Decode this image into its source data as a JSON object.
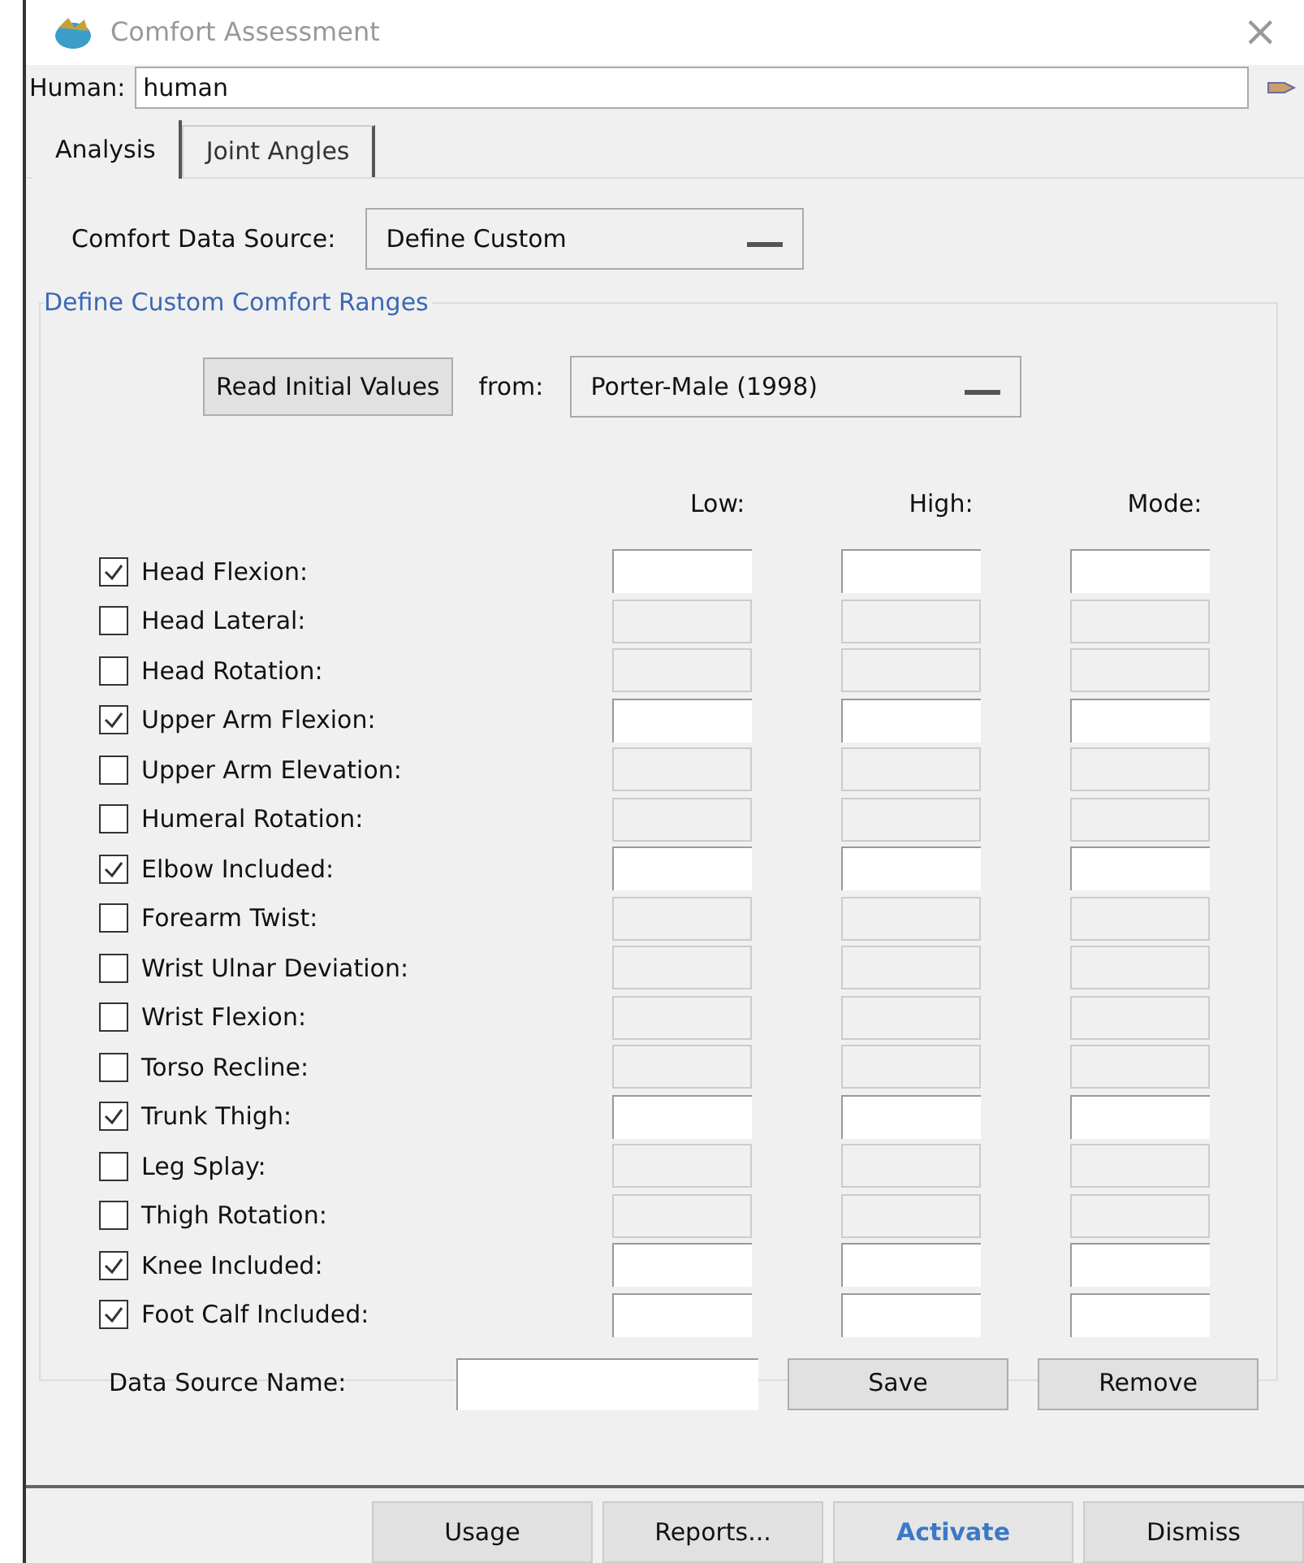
{
  "window": {
    "title": "Comfort Assessment",
    "close": "×"
  },
  "human": {
    "label": "Human:",
    "value": "human"
  },
  "tabs": [
    {
      "label": "Analysis",
      "selected": true
    },
    {
      "label": "Joint Angles",
      "selected": false
    }
  ],
  "source": {
    "label": "Comfort Data Source:",
    "value": "Define Custom"
  },
  "group": {
    "title": "Define Custom Comfort Ranges",
    "read_button": "Read Initial Values",
    "from_label": "from:",
    "from_value": "Porter-Male (1998)",
    "columns": [
      "Low:",
      "High:",
      "Mode:"
    ],
    "rows": [
      {
        "label": "Head Flexion:",
        "checked": true
      },
      {
        "label": "Head Lateral:",
        "checked": false
      },
      {
        "label": "Head Rotation:",
        "checked": false
      },
      {
        "label": "Upper Arm Flexion:",
        "checked": true
      },
      {
        "label": "Upper Arm Elevation:",
        "checked": false
      },
      {
        "label": "Humeral Rotation:",
        "checked": false
      },
      {
        "label": "Elbow Included:",
        "checked": true
      },
      {
        "label": "Forearm Twist:",
        "checked": false
      },
      {
        "label": "Wrist Ulnar Deviation:",
        "checked": false
      },
      {
        "label": "Wrist Flexion:",
        "checked": false
      },
      {
        "label": "Torso Recline:",
        "checked": false
      },
      {
        "label": "Trunk Thigh:",
        "checked": true
      },
      {
        "label": "Leg Splay:",
        "checked": false
      },
      {
        "label": "Thigh Rotation:",
        "checked": false
      },
      {
        "label": "Knee Included:",
        "checked": true
      },
      {
        "label": "Foot Calf Included:",
        "checked": true
      }
    ],
    "name_label": "Data Source Name:",
    "save": "Save",
    "remove": "Remove"
  },
  "buttons": [
    {
      "label": "Usage",
      "default": false
    },
    {
      "label": "Reports...",
      "default": false
    },
    {
      "label": "Activate",
      "default": true
    },
    {
      "label": "Dismiss",
      "default": false
    }
  ]
}
